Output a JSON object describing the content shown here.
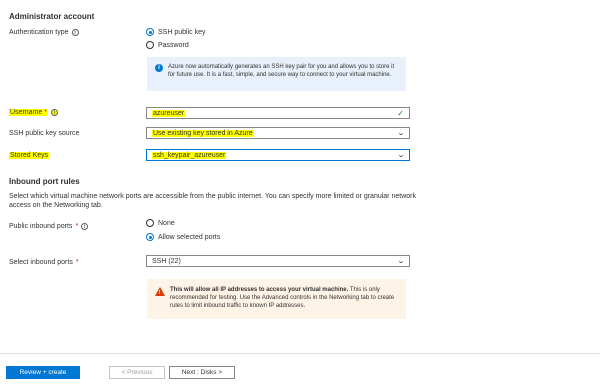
{
  "admin": {
    "title": "Administrator account",
    "auth_type_label": "Authentication type",
    "auth_options": [
      "SSH public key",
      "Password"
    ],
    "auth_selected": "SSH public key",
    "info_text": "Azure now automatically generates an SSH key pair for you and allows you to store it for future use. It is a fast, simple, and secure way to connect to your virtual machine.",
    "username_label": "Username",
    "username_value": "azureuser",
    "ssh_source_label": "SSH public key source",
    "ssh_source_value": "Use existing key stored in Azure",
    "stored_keys_label": "Stored Keys",
    "stored_keys_value": "ssh_keypair_azureuser"
  },
  "inbound": {
    "title": "Inbound port rules",
    "description": "Select which virtual machine network ports are accessible from the public internet. You can specify more limited or granular network access on the Networking tab.",
    "public_ports_label": "Public inbound ports",
    "public_ports_options": [
      "None",
      "Allow selected ports"
    ],
    "public_ports_selected": "Allow selected ports",
    "select_ports_label": "Select inbound ports",
    "select_ports_value": "SSH (22)",
    "warning_bold": "This will allow all IP addresses to access your virtual machine.",
    "warning_text": " This is only recommended for testing.  Use the Advanced controls in the Networking tab to create rules to limit inbound traffic to known IP addresses."
  },
  "footer": {
    "review_label": "Review + create",
    "previous_label": "< Previous",
    "next_label": "Next : Disks >"
  },
  "colors": {
    "accent": "#0078d4",
    "highlight": "#ffff00",
    "warning": "#d83b01",
    "success": "#107c10"
  },
  "icons": [
    "info-icon",
    "checkmark-icon",
    "chevron-down-icon",
    "warning-icon"
  ]
}
